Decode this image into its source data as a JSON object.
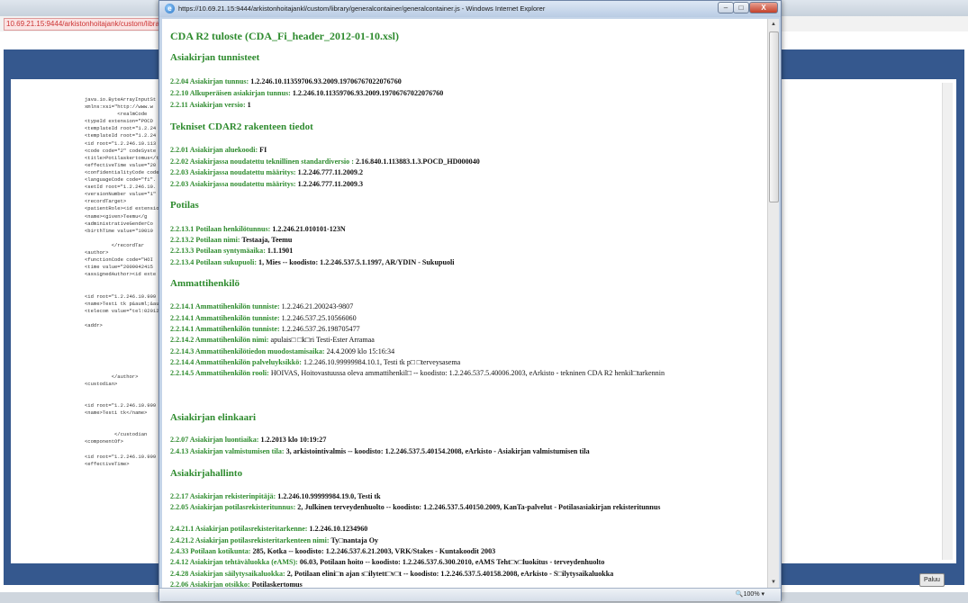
{
  "background": {
    "address": "10.69.21.15:9444/arkistonhoitajank/custom/library",
    "paluu_label": "Paluu",
    "xml_lines": [
      "java.io.ByteArrayInputSt",
      "xmlns:xsi=\"http://www.w",
      "           <realmCode",
      "<typeId extension=\"POCD",
      "<templateId root=\"1.2.24",
      "<templateId root=\"1.2.24",
      "<id root=\"1.2.246.10.113",
      "<code code=\"2\" codeSyste",
      "<title>Potilaskertomus</t",
      "<effectiveTime value=\"20",
      "<confidentialityCode code",
      "<languageCode code=\"fi\".",
      "<setId root=\"1.2.246.10.",
      "<versionNumber value=\"1\"",
      "<recordTarget>",
      "<patientRole><id extensio",
      "<name><given>Teemu</g",
      "<administrativeGenderCo",
      "<birthTime value=\"19010",
      "",
      "         </recordTar",
      "<author>",
      "<functionCode code=\"HOI",
      "<time value=\"2009042415",
      "<assignedAuthor><id exte",
      "",
      "",
      "<id root=\"1.2.246.10.999",
      "<name>Testi tk p&auml;&auml;ter",
      "<telecom value=\"tel:02012",
      "",
      "<addr>",
      "",
      "",
      "",
      "",
      "",
      "",
      "         </author>",
      "<custodian>",
      "",
      "",
      "<id root=\"1.2.246.10.999",
      "<name>Testi tk</name>",
      "",
      "",
      "          </custodian",
      "<componentOf>",
      "",
      "<id root=\"1.2.246.10.999",
      "<effectiveTime>"
    ]
  },
  "window": {
    "title": "https://10.69.21.15:9444/arkistonhoitajankl/custom/library/generalcontainer/generalcontainer.js - Windows Internet Explorer",
    "min_label": "–",
    "max_label": "□",
    "close_label": "X",
    "zoom": "🔍100%  ▾"
  },
  "document": {
    "title": "CDA R2 tuloste (CDA_Fi_header_2012-01-10.xsl)",
    "sections": [
      {
        "heading": "Asiakirjan tunnisteet",
        "lines": [
          {
            "label": "2.2.04 Asiakirjan tunnus:",
            "value": " 1.2.246.10.11359706.93.2009.19706767022076760"
          },
          {
            "label": "2.2.10 Alkuperäisen asiakirjan tunnus:",
            "value": " 1.2.246.10.11359706.93.2009.19706767022076760"
          },
          {
            "label": "2.2.11 Asiakirjan versio:",
            "value": " 1"
          }
        ]
      },
      {
        "heading": "Tekniset CDAR2 rakenteen tiedot",
        "lines": [
          {
            "label": "2.2.01 Asiakirjan aluekoodi:",
            "value": " FI"
          },
          {
            "label": "2.2.02 Asiakirjassa noudatettu teknillinen standardiversio :",
            "value": " 2.16.840.1.113883.1.3.POCD_HD000040"
          },
          {
            "label": "2.2.03 Asiakirjassa noudatettu määritys:",
            "value": " 1.2.246.777.11.2009.2"
          },
          {
            "label": "2.2.03 Asiakirjassa noudatettu määritys:",
            "value": " 1.2.246.777.11.2009.3"
          }
        ]
      },
      {
        "heading": "Potilas",
        "lines": [
          {
            "label": "2.2.13.1 Potilaan henkilötunnus:",
            "value": " 1.2.246.21.010101-123N"
          },
          {
            "label": "2.2.13.2 Potilaan nimi:",
            "value": " Testaaja, Teemu"
          },
          {
            "label": "2.2.13.3 Potilaan syntymäaika:",
            "value": " 1.1.1901"
          },
          {
            "label": "2.2.13.4 Potilaan sukupuoli:",
            "value": " 1,  Mies -- koodisto:  1.2.246.537.5.1.1997,  AR/YDIN - Sukupuoli"
          }
        ]
      },
      {
        "heading": "Ammattihenkilö",
        "lines": [
          {
            "label": "2.2.14.1 Ammattihenkilön tunniste:",
            "value": " 1.2.246.21.200243-9807"
          },
          {
            "label": "2.2.14.1 Ammattihenkilön tunniste:",
            "value": " 1.2.246.537.25.10566060"
          },
          {
            "label": "2.2.14.1 Ammattihenkilön tunniste:",
            "value": " 1.2.246.537.26.198705477"
          },
          {
            "label": "2.2.14.2 Ammattihenkilön nimi:",
            "value": " apulais□ □k□ri Testi-Ester Arramaa"
          },
          {
            "label": "2.2.14.3 Ammattihenkilötiedon muodostamisaika:",
            "value": " 24.4.2009 klo 15:16:34"
          },
          {
            "label": "2.2.14.4 Ammattihenkilön palveluyksikkö:",
            "value": " 1.2.246.10.99999984.10.1, Testi tk p□ □terveysasema"
          },
          {
            "label": "2.2.14.5 Ammattihenkilön rooli:",
            "value": " HOIVAS,  Hoitovastuussa oleva ammattihenkil□  -- koodisto:  1.2.246.537.5.40006.2003,  eArkisto - tekninen CDA R2 henkil□tarkennin"
          }
        ]
      },
      {
        "heading": "Asiakirjan elinkaari",
        "lines": [
          {
            "label": "2.2.07 Asiakirjan luontiaika:",
            "value": " 1.2.2013 klo 10:19:27"
          },
          {
            "label": "2.4.13 Asiakirjan valmistumisen tila:",
            "value": " 3,  arkistointivalmis -- koodisto:  1.2.246.537.5.40154.2008,  eArkisto - Asiakirjan valmistumisen tila"
          }
        ]
      },
      {
        "heading": "Asiakirjahallinto",
        "lines": [
          {
            "label": "2.2.17 Asiakirjan rekisterinpitäjä:",
            "value": " 1.2.246.10.99999984.19.0, Testi tk"
          },
          {
            "label": "2.2.05 Asiakirjan potilasrekisteritunnus:",
            "value": " 2,  Julkinen terveydenhuolto -- koodisto:  1.2.246.537.5.40150.2009,  KanTa-palvelut - Potilasasiakirjan rekisteritunnus"
          },
          {
            "label": "2.4.21.1 Asiakirjan potilasrekisteritarkenne:",
            "value": " 1.2.246.10.1234960"
          },
          {
            "label": "2.4.21.2 Asiakirjan potilasrekisteritarkenteen nimi:",
            "value": " Ty□nantaja Oy"
          },
          {
            "label": "2.4.33 Potilaan kotikunta:",
            "value": " 285,  Kotka -- koodisto:  1.2.246.537.6.21.2003,  VRK/Stakes - Kuntakoodit 2003"
          },
          {
            "label": "2.4.12 Asiakirjan tehtäväluokka (eAMS):",
            "value": " 06.03,  Potilaan hoito -- koodisto:  1.2.246.537.6.300.2010,  eAMS Teht□v□luokitus - terveydenhuolto"
          },
          {
            "label": "2.4.28 Asiakirjan säilytysaikaluokka:",
            "value": " 2,  Potilaan elini□n ajan s□ilytett□v□t -- koodisto:  1.2.246.537.5.40158.2008,  eArkisto - S□ilytysaikaluokka"
          },
          {
            "label": "2.2.06 Asiakirjan otsikko:",
            "value": " Potilaskertomus"
          }
        ]
      }
    ]
  }
}
